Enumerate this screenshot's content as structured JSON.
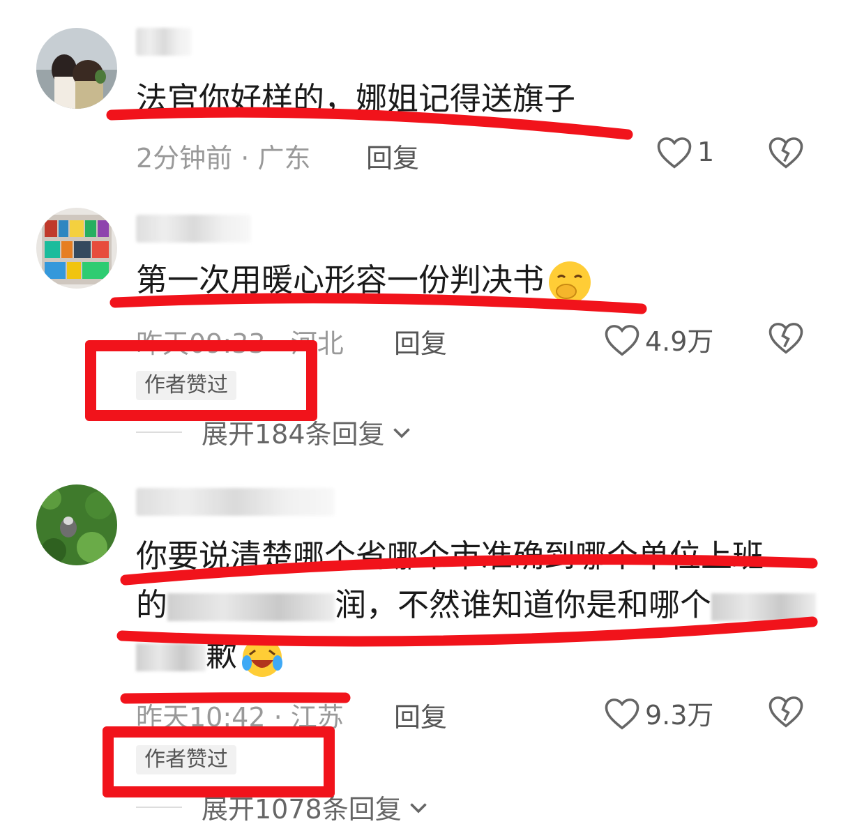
{
  "comments": [
    {
      "text": "法官你好样的，娜姐记得送旗子",
      "time": "2分钟前",
      "location": "广东",
      "reply_label": "回复",
      "likes": "1"
    },
    {
      "text": "第一次用暖心形容一份判决书",
      "time": "昨天09:33",
      "location": "河北",
      "reply_label": "回复",
      "likes": "4.9万",
      "tag": "作者赞过",
      "expand": "展开184条回复"
    },
    {
      "line1": "你要说清楚哪个省哪个市准确到哪个单位上班",
      "line2_start": "的",
      "line2_mid": "润，不然谁知道你是和哪个",
      "line3_end": "歉",
      "time": "昨天10:42",
      "location": "江苏",
      "reply_label": "回复",
      "likes": "9.3万",
      "tag": "作者赞过",
      "expand": "展开1078条回复"
    }
  ],
  "meta_separator": " · ",
  "colors": {
    "highlight_red": "#f1131b",
    "meta_gray": "#999999",
    "text_dark": "#1a1a1a"
  },
  "icons": [
    "heart-outline-icon",
    "broken-heart-icon",
    "chevron-down-icon",
    "smiling-emoji-icon",
    "laughing-crying-emoji-icon"
  ]
}
